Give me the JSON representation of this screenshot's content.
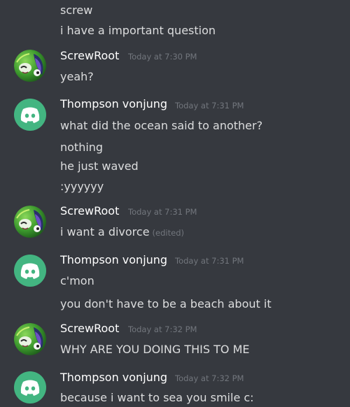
{
  "messages": {
    "m0": {
      "line1": "screw",
      "line2": "i have a important question"
    },
    "m1": {
      "author": "ScrewRoot",
      "time": "Today at 7:30 PM",
      "line1": "yeah?"
    },
    "m2": {
      "author": "Thompson vonjung",
      "time": "Today at 7:31 PM",
      "line1": "what did the ocean said to another?",
      "line2": "nothing",
      "line3": "he just waved",
      "line4": ":yyyyyy"
    },
    "m3": {
      "author": "ScrewRoot",
      "time": "Today at 7:31 PM",
      "line1": "i want a divorce",
      "edited": "(edited)"
    },
    "m4": {
      "author": "Thompson vonjung",
      "time": "Today at 7:31 PM",
      "line1": "c'mon",
      "line2": "you don't have to be a beach about it"
    },
    "m5": {
      "author": "ScrewRoot",
      "time": "Today at 7:32 PM",
      "line1": "WHY ARE YOU DOING THIS TO ME"
    },
    "m6": {
      "author": "Thompson vonjung",
      "time": "Today at 7:32 PM",
      "line1": "because i want to sea you smile c:"
    }
  },
  "colors": {
    "background": "#36393f",
    "username": "#ffffff",
    "message_text": "#dcddde",
    "timestamp": "#72767d",
    "discord_avatar": "#43b581"
  },
  "icons": {
    "screwroot_avatar": "green-character-avatar-icon",
    "discord_default_avatar": "discord-logo-icon"
  }
}
